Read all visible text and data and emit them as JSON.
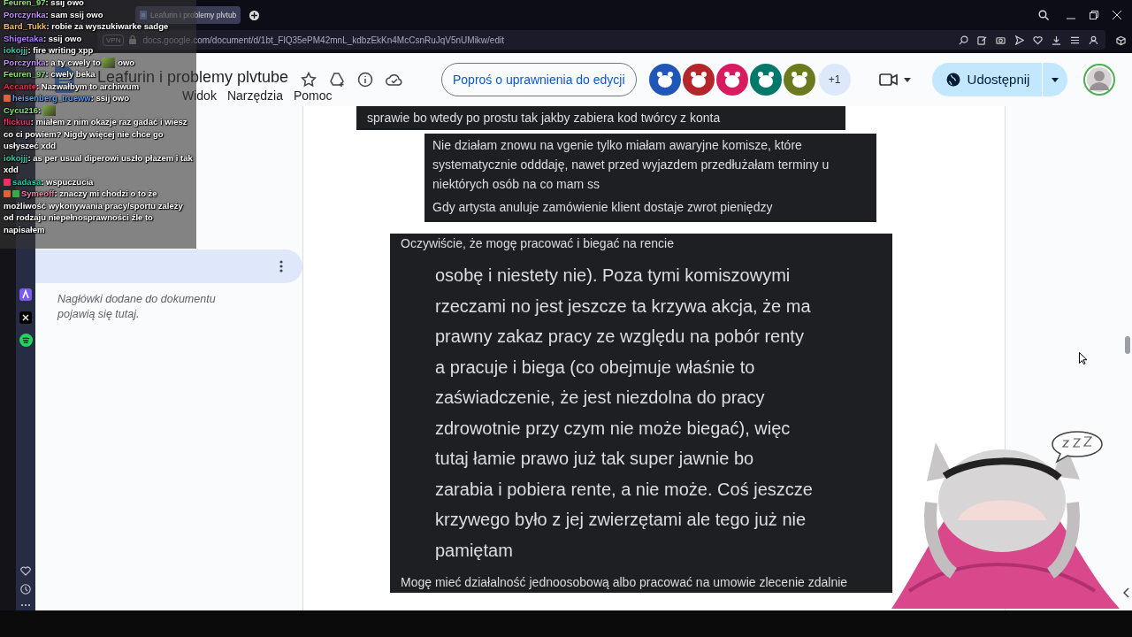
{
  "browser": {
    "tabs": [
      {
        "title": "Leafurin i problemy plvtub",
        "selected": true
      }
    ],
    "vpn_label": "VPN",
    "url": "docs.google.com/document/d/1bt_FlQ35ePM42mnL_kdbzEkKn4McCsnRuJqV5nUMikw/edit"
  },
  "document": {
    "title": "Leafurin i problemy plvtube",
    "menu": [
      "Widok",
      "Narzędzia",
      "Pomoc"
    ],
    "request_edit_button": "Poproś o uprawnienia do edycji",
    "collaborators": [
      {
        "color": "#1f56b8"
      },
      {
        "color": "#b3262b"
      },
      {
        "color": "#d81b60"
      },
      {
        "color": "#00796b"
      },
      {
        "color": "#6b7a1f"
      }
    ],
    "more_collaborators": "+1",
    "share_button": "Udostępnij"
  },
  "outline": {
    "tab_selected": true,
    "empty_hint": "Nagłówki dodane do dokumentu pojawią się tutaj."
  },
  "page": {
    "blocks": [
      {
        "kind": "message",
        "paragraphs": [
          "sprawie bo wtedy po prostu tak jakby zabiera kod twórcy z konta"
        ]
      },
      {
        "kind": "message",
        "paragraphs": [
          "Nie działam znowu na vgenie tylko miałam awaryjne komisze, które systematycznie odddaję, nawet przed wyjazdem przedłużałam terminy u niektórych osób na co mam ss",
          "Gdy artysta anuluje zamówienie klient dostaje zwrot pieniędzy"
        ]
      },
      {
        "kind": "quote",
        "header": "Oczywiście, że mogę pracować i biegać na rencie",
        "body": "osobę i niestety nie). Poza tymi komiszowymi\nrzeczami no jest jeszcze ta krzywa akcja, że ma\nprawny zakaz pracy ze względu na pobór renty\na pracuje i biega (co obejmuje właśnie to\nzaświadczenie, że jest niezdolna do pracy\nzdrowotnie przy czym nie może biegać), więc\ntutaj łamie prawo już tak super jawnie bo\nzarabia i pobiera rente, a nie może. Coś jeszcze\nkrzywego było z jej zwierzętami ale tego już nie\npamiętam",
        "footer": "Mogę mieć działalność jednoosobową albo pracować na umowie zlecenie zdalnie"
      }
    ]
  },
  "chat": [
    {
      "user": "Feuren_97",
      "color": "#86e07a",
      "separator": ":",
      "parts": [
        {
          "kind": "text",
          "text": "ssij owo"
        }
      ]
    },
    {
      "user": "Porczynka",
      "color": "#c48cff",
      "separator": ":",
      "parts": [
        {
          "kind": "text",
          "text": "sam ssij owo"
        }
      ]
    },
    {
      "user": "Bard_Tukk",
      "color": "#f2b866",
      "separator": ":",
      "parts": [
        {
          "kind": "text",
          "text": "robie za wyszukiwarke sadge"
        }
      ]
    },
    {
      "user": "Shigetaka",
      "color": "#b07cff",
      "separator": ":",
      "parts": [
        {
          "kind": "text",
          "text": "ssij owo"
        }
      ]
    },
    {
      "user": "iokojjj",
      "color": "#2fc9a6",
      "separator": ":",
      "parts": [
        {
          "kind": "text",
          "text": "fire writing xpp"
        }
      ]
    },
    {
      "user": "Porczynka",
      "color": "#c48cff",
      "separator": ":",
      "parts": [
        {
          "kind": "text",
          "text": "a ty cwely to"
        },
        {
          "kind": "emote"
        },
        {
          "kind": "text",
          "text": "owo"
        }
      ]
    },
    {
      "user": "Feuren_97",
      "color": "#86e07a",
      "separator": ":",
      "parts": [
        {
          "kind": "text",
          "text": "cwely beka"
        }
      ]
    },
    {
      "user": "Accante",
      "color": "#e8304f",
      "separator": ":",
      "parts": [
        {
          "kind": "text",
          "text": "Nazwałbym to archiwum"
        }
      ]
    },
    {
      "user": "heisenberg_trueww",
      "color": "#5b9cff",
      "separator": ":",
      "badges": [
        {
          "color": "#e0603a"
        }
      ],
      "parts": [
        {
          "kind": "text",
          "text": "ssij owo"
        }
      ]
    },
    {
      "user": "Cycu216",
      "color": "#86e07a",
      "separator": ":",
      "parts": [
        {
          "kind": "emote"
        }
      ]
    },
    {
      "user": "flickuu",
      "color": "#e8306a",
      "separator": ":",
      "parts": [
        {
          "kind": "text",
          "text": "miałem z nim okazje raz gadać i wiesz co ci powiem? Nigdy więcej nie chce go usłyszeć xdd"
        }
      ]
    },
    {
      "user": "iokojjj",
      "color": "#2fc9a6",
      "separator": ":",
      "parts": [
        {
          "kind": "text",
          "text": "as per usual diperowi uszło płazem i tak xdd"
        }
      ]
    },
    {
      "user": "sadasa",
      "color": "#2fc9a6",
      "separator": ":",
      "badges": [
        {
          "color": "#e8306a"
        }
      ],
      "parts": [
        {
          "kind": "text",
          "text": "wspuczucia"
        }
      ]
    },
    {
      "user": "Symeoff",
      "color": "#e884a8",
      "separator": ":",
      "badges": [
        {
          "color": "#e0603a"
        },
        {
          "color": "#3aa845"
        }
      ],
      "parts": [
        {
          "kind": "text",
          "text": "znaczy mi chodzi o to że możliwość wykonywania pracy/sportu zależy od rodzaju niepełnosprawności źle to napisałem"
        }
      ]
    }
  ]
}
